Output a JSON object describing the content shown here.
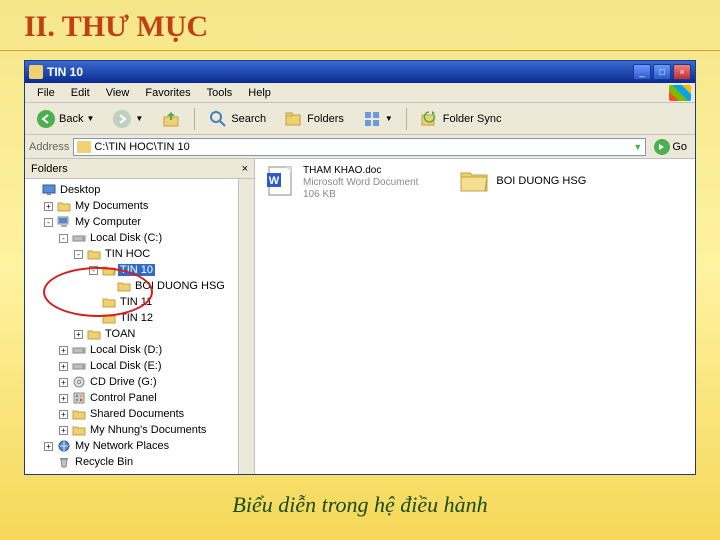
{
  "slide": {
    "title": "II. THƯ MỤC",
    "caption": "Biểu diễn trong hệ điều hành"
  },
  "titlebar": {
    "text": "TIN 10"
  },
  "menu": {
    "file": "File",
    "edit": "Edit",
    "view": "View",
    "favorites": "Favorites",
    "tools": "Tools",
    "help": "Help"
  },
  "toolbar": {
    "back": "Back",
    "search": "Search",
    "folders": "Folders",
    "foldersync": "Folder Sync"
  },
  "addressbar": {
    "label": "Address",
    "path": "C:\\TIN HOC\\TIN 10",
    "go": "Go"
  },
  "foldersPane": {
    "title": "Folders"
  },
  "tree": {
    "desktop": "Desktop",
    "mydocs": "My Documents",
    "mycomp": "My Computer",
    "cdrive": "Local Disk (C:)",
    "tinhoc": "TIN HOC",
    "tin10": "TIN 10",
    "boiduong": "BOI DUONG HSG",
    "tin11": "TIN 11",
    "tin12": "TIN 12",
    "toan": "TOAN",
    "ddrive": "Local Disk (D:)",
    "edrive": "Local Disk (E:)",
    "cddrive": "CD Drive (G:)",
    "cpanel": "Control Panel",
    "shared": "Shared Documents",
    "nhung": "My Nhung's Documents",
    "netplaces": "My Network Places",
    "recycle": "Recycle Bin"
  },
  "content": {
    "file": {
      "name": "THAM KHAO.doc",
      "type": "Microsoft Word Document",
      "size": "106 KB"
    },
    "folder": {
      "name": "BOI DUONG HSG"
    }
  }
}
